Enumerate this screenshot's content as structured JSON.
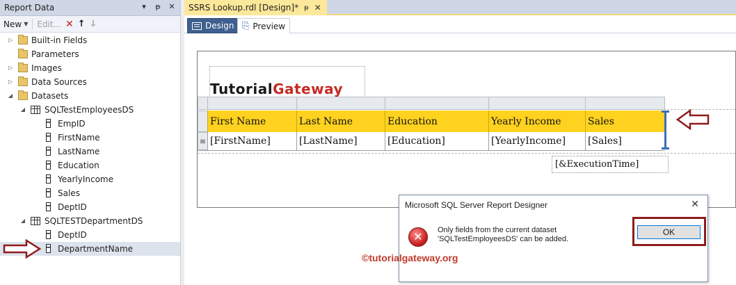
{
  "report_data_pane": {
    "title": "Report Data",
    "title_icons": [
      "dropdown-icon",
      "pin-icon",
      "close-icon"
    ],
    "toolbar": {
      "new_label": "New",
      "edit_label": "Edit...",
      "delete_icon": "delete-icon",
      "up_icon": "move-up-icon",
      "down_icon": "move-down-icon"
    },
    "tree": [
      {
        "label": "Built-in Fields",
        "icon": "folder-icon",
        "expander": "collapsed"
      },
      {
        "label": "Parameters",
        "icon": "folder-icon",
        "expander": "none"
      },
      {
        "label": "Images",
        "icon": "folder-icon",
        "expander": "collapsed"
      },
      {
        "label": "Data Sources",
        "icon": "folder-icon",
        "expander": "collapsed"
      },
      {
        "label": "Datasets",
        "icon": "folder-icon",
        "expander": "expanded"
      },
      {
        "label": "SQLTestEmployeesDS",
        "icon": "table-icon",
        "expander": "expanded"
      },
      {
        "label": "EmpID",
        "icon": "field-icon"
      },
      {
        "label": "FirstName",
        "icon": "field-icon"
      },
      {
        "label": "LastName",
        "icon": "field-icon"
      },
      {
        "label": "Education",
        "icon": "field-icon"
      },
      {
        "label": "YearlyIncome",
        "icon": "field-icon"
      },
      {
        "label": "Sales",
        "icon": "field-icon"
      },
      {
        "label": "DeptID",
        "icon": "field-icon"
      },
      {
        "label": "SQLTESTDepartmentDS",
        "icon": "table-icon",
        "expander": "expanded"
      },
      {
        "label": "DeptID",
        "icon": "field-icon"
      },
      {
        "label": "DepartmentName",
        "icon": "field-icon",
        "selected": true
      }
    ]
  },
  "document": {
    "tab_title": "SSRS Lookup.rdl [Design]*",
    "view_tabs": {
      "design": "Design",
      "preview": "Preview"
    },
    "report": {
      "logo": {
        "part1": "Tutorial",
        "part2": "Gateway"
      },
      "table_headers": [
        "First Name",
        "Last Name",
        "Education",
        "Yearly Income",
        "Sales"
      ],
      "table_detail": [
        "[FirstName]",
        "[LastName]",
        "[Education]",
        "[YearlyIncome]",
        "[Sales]"
      ],
      "row_handle_glyph": "≡",
      "footer_expression": "[&ExecutionTime]"
    }
  },
  "dialog": {
    "title": "Microsoft SQL Server Report Designer",
    "message_line1": "Only fields from the current dataset",
    "message_line2": "'SQLTestEmployeesDS' can be added.",
    "ok_label": "OK",
    "close_glyph": "✕",
    "icon": "error-icon"
  },
  "watermark": "©tutorialgateway.org",
  "colors": {
    "header_fill": "#ffd21f",
    "annotation_red": "#8e1c1c",
    "active_tab": "#3f5f8e",
    "doc_tab": "#fce89a",
    "selection_bracket": "#3b6fb5"
  }
}
